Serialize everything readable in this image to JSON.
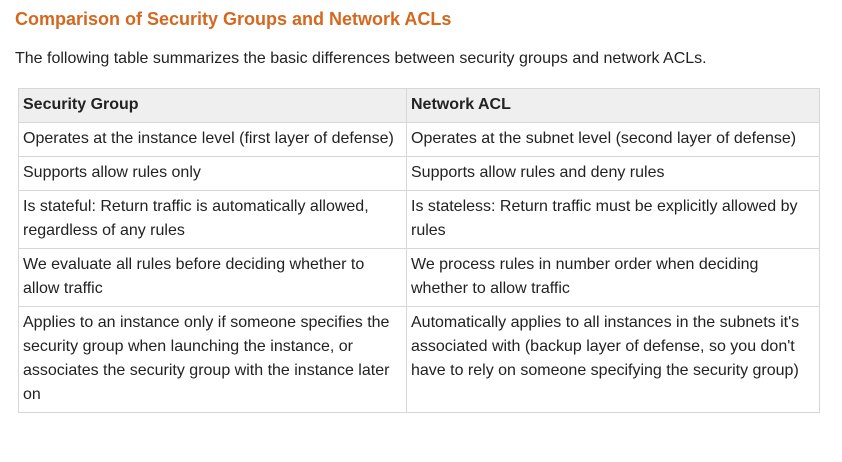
{
  "heading": "Comparison of Security Groups and Network ACLs",
  "intro": "The following table summarizes the basic differences between security groups and network ACLs.",
  "table": {
    "headers": [
      "Security Group",
      "Network ACL"
    ],
    "rows": [
      [
        "Operates at the instance level (first layer of defense)",
        "Operates at the subnet level (second layer of defense)"
      ],
      [
        "Supports allow rules only",
        "Supports allow rules and deny rules"
      ],
      [
        "Is stateful: Return traffic is automatically allowed, regardless of any rules",
        "Is stateless: Return traffic must be explicitly allowed by rules"
      ],
      [
        "We evaluate all rules before deciding whether to allow traffic",
        "We process rules in number order when deciding whether to allow traffic"
      ],
      [
        "Applies to an instance only if someone specifies the security group when launching the instance, or associates the security group with the instance later on",
        "Automatically applies to all instances in the subnets it's associated with (backup layer of defense, so you don't have to rely on someone specifying the security group)"
      ]
    ]
  },
  "colors": {
    "heading": "#d5681f",
    "header_bg": "#efefef",
    "border": "#d7d7d7",
    "text": "#222222"
  }
}
